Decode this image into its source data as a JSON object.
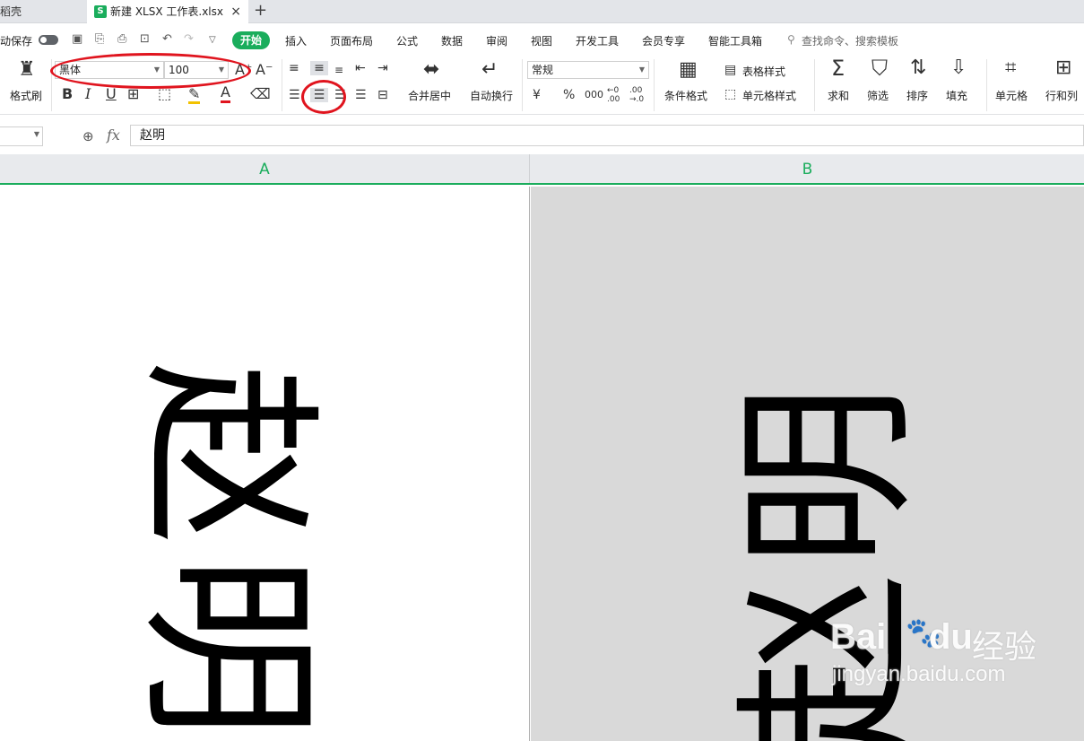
{
  "tabs": {
    "previous_label": "稻壳",
    "active_label": "新建 XLSX 工作表.xlsx",
    "active_badge": "S",
    "close_glyph": "×",
    "new_tab_glyph": "+"
  },
  "menubar": {
    "autosave_label": "动保存",
    "quick_access": [
      "save-icon",
      "export-icon",
      "print-icon",
      "print-preview-icon",
      "undo-icon",
      "redo-icon",
      "more-icon"
    ],
    "items": [
      "开始",
      "插入",
      "页面布局",
      "公式",
      "数据",
      "审阅",
      "视图",
      "开发工具",
      "会员专享",
      "智能工具箱"
    ],
    "search_placeholder": "查找命令、搜索模板"
  },
  "ribbon": {
    "format_painter_label": "格式刷",
    "font_name": "黑体",
    "font_size": "100",
    "bold": "B",
    "italic": "I",
    "underline": "U",
    "font_color_glyph": "A",
    "grow_font": "A⁺",
    "shrink_font": "A⁻",
    "merge_center_label": "合并居中",
    "wrap_text_label": "自动换行",
    "number_format": "常规",
    "currency": "¥",
    "percent": "%",
    "thousands": "000",
    "increase_decimal": "←0\n.00",
    "decrease_decimal": ".00\n→.0",
    "conditional_format_label": "条件格式",
    "table_style_label": "表格样式",
    "cell_style_label": "单元格样式",
    "sum_label": "求和",
    "filter_label": "筛选",
    "sort_label": "排序",
    "fill_label": "填充",
    "cell_label": "单元格",
    "row_col_label": "行和列",
    "accent_color": "#1aad5c",
    "annotation_color": "#e0141e"
  },
  "formula_bar": {
    "fx_label": "fx",
    "value": "赵明"
  },
  "columns": [
    "A",
    "B"
  ],
  "cells": {
    "a_char1": "赵",
    "a_char2": "明",
    "b_char1": "明",
    "b_char2": "赵"
  },
  "watermark": {
    "brand": "Bai",
    "brand2": "du",
    "product": "经验",
    "url": "jingyan.baidu.com"
  }
}
